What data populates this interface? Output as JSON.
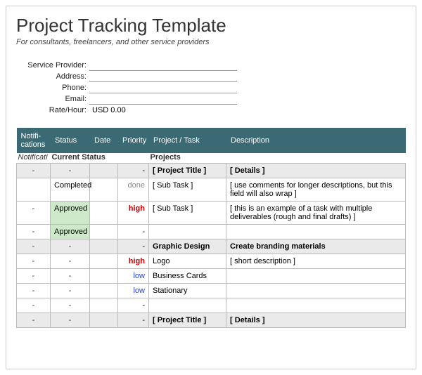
{
  "title": "Project Tracking Template",
  "subtitle": "For consultants, freelancers, and other service providers",
  "info": {
    "provider_label": "Service Provider:",
    "provider_value": "",
    "address_label": "Address:",
    "address_value": "",
    "phone_label": "Phone:",
    "phone_value": "",
    "email_label": "Email:",
    "email_value": "",
    "rate_label": "Rate/Hour:",
    "rate_value": "USD 0.00"
  },
  "sections": {
    "notifications": "Notificati",
    "current_status": "Current Status",
    "projects": "Projects"
  },
  "headers": {
    "notifications": "Notifi-cations",
    "status": "Status",
    "date": "Date",
    "priority": "Priority",
    "project": "Project / Task",
    "description": "Description"
  },
  "rows": [
    {
      "n": "-",
      "status": "-",
      "status_class": "grey",
      "date": "",
      "prio": "-",
      "prio_class": "grey right",
      "proj": "[ Project Title ]",
      "proj_class": "grey boldcell",
      "desc": "[ Details ]",
      "desc_class": "grey boldcell"
    },
    {
      "n": "",
      "status": "Completed",
      "status_class": "",
      "date": "",
      "prio": "done",
      "prio_class": "done",
      "proj": "[ Sub Task ]",
      "proj_class": "",
      "desc": "[ use comments for longer descriptions, but this field will also wrap ]",
      "desc_class": ""
    },
    {
      "n": "-",
      "status": "Approved",
      "status_class": "approved",
      "date": "",
      "prio": "high",
      "prio_class": "high",
      "proj": "[ Sub Task ]",
      "proj_class": "",
      "desc": "[ this is an example of a task with multiple deliverables (rough and final drafts) ]",
      "desc_class": ""
    },
    {
      "n": "-",
      "status": "Approved",
      "status_class": "approved",
      "date": "",
      "prio": "-",
      "prio_class": "right",
      "proj": "",
      "proj_class": "",
      "desc": "",
      "desc_class": ""
    },
    {
      "n": "-",
      "status": "-",
      "status_class": "grey",
      "date": "",
      "prio": "-",
      "prio_class": "grey right",
      "proj": "Graphic Design",
      "proj_class": "grey boldcell",
      "desc": "Create branding materials",
      "desc_class": "grey boldcell"
    },
    {
      "n": "-",
      "status": "-",
      "status_class": "",
      "date": "",
      "prio": "high",
      "prio_class": "high",
      "proj": "Logo",
      "proj_class": "",
      "desc": "[ short description ]",
      "desc_class": ""
    },
    {
      "n": "-",
      "status": "-",
      "status_class": "",
      "date": "",
      "prio": "low",
      "prio_class": "low",
      "proj": "Business Cards",
      "proj_class": "",
      "desc": "",
      "desc_class": ""
    },
    {
      "n": "-",
      "status": "-",
      "status_class": "",
      "date": "",
      "prio": "low",
      "prio_class": "low",
      "proj": "Stationary",
      "proj_class": "",
      "desc": "",
      "desc_class": ""
    },
    {
      "n": "-",
      "status": "-",
      "status_class": "",
      "date": "",
      "prio": "-",
      "prio_class": "right",
      "proj": "",
      "proj_class": "",
      "desc": "",
      "desc_class": ""
    },
    {
      "n": "-",
      "status": "-",
      "status_class": "grey",
      "date": "",
      "prio": "-",
      "prio_class": "grey right",
      "proj": "[ Project Title ]",
      "proj_class": "grey boldcell",
      "desc": "[ Details ]",
      "desc_class": "grey boldcell"
    }
  ]
}
